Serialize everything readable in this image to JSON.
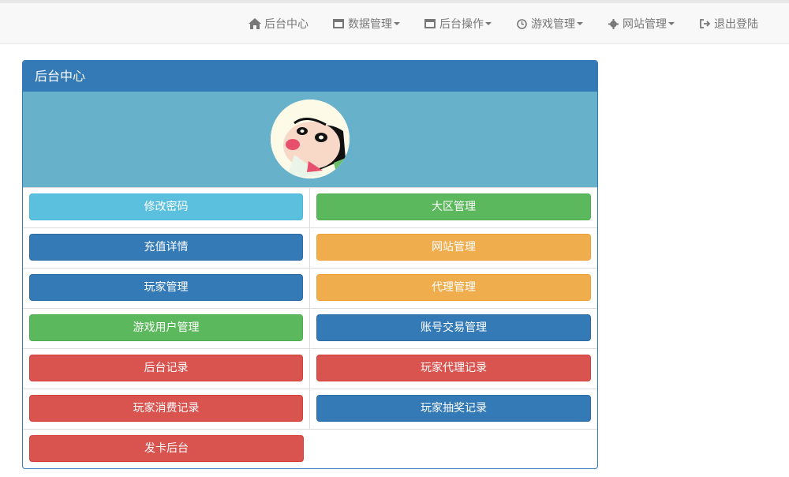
{
  "nav": {
    "items": [
      {
        "label": "后台中心",
        "icon": "home-icon",
        "dropdown": false
      },
      {
        "label": "数据管理",
        "icon": "window-icon",
        "dropdown": true
      },
      {
        "label": "后台操作",
        "icon": "window-icon",
        "dropdown": true
      },
      {
        "label": "游戏管理",
        "icon": "clock-icon",
        "dropdown": true
      },
      {
        "label": "网站管理",
        "icon": "gear-icon",
        "dropdown": true
      },
      {
        "label": "退出登陆",
        "icon": "logout-icon",
        "dropdown": false
      }
    ]
  },
  "panel": {
    "title": "后台中心",
    "avatar_icon": "cartoon-avatar",
    "buttons": [
      {
        "label": "修改密码",
        "style": "info"
      },
      {
        "label": "大区管理",
        "style": "success"
      },
      {
        "label": "充值详情",
        "style": "primary"
      },
      {
        "label": "网站管理",
        "style": "warning"
      },
      {
        "label": "玩家管理",
        "style": "primary"
      },
      {
        "label": "代理管理",
        "style": "warning"
      },
      {
        "label": "游戏用户管理",
        "style": "success"
      },
      {
        "label": "账号交易管理",
        "style": "primary"
      },
      {
        "label": "后台记录",
        "style": "danger"
      },
      {
        "label": "玩家代理记录",
        "style": "danger"
      },
      {
        "label": "玩家消费记录",
        "style": "danger"
      },
      {
        "label": "玩家抽奖记录",
        "style": "primary"
      },
      {
        "label": "发卡后台",
        "style": "danger"
      }
    ]
  },
  "colors": {
    "primary": "#337ab7",
    "info": "#5bc0de",
    "success": "#5cb85c",
    "warning": "#f0ad4e",
    "danger": "#d9534f",
    "banner": "#67b1cb"
  }
}
